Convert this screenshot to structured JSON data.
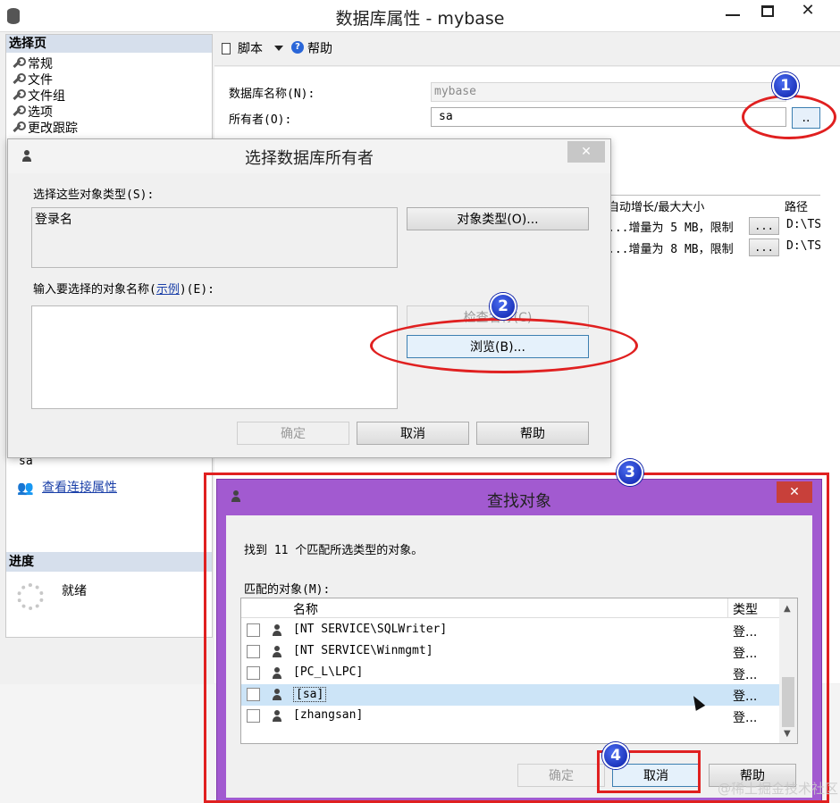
{
  "main_window": {
    "title": "数据库属性 - mybase"
  },
  "left_panel": {
    "header": "选择页",
    "items": [
      "常规",
      "文件",
      "文件组",
      "选项",
      "更改跟踪"
    ],
    "connection_value": "sa",
    "view_connection_link": "查看连接属性",
    "progress_header": "进度",
    "progress_status": "就绪"
  },
  "toolbar": {
    "script_label": "脚本",
    "help_label": "帮助"
  },
  "general": {
    "db_name_label": "数据库名称(N):",
    "db_name_value": "mybase",
    "owner_label": "所有者(O):",
    "owner_value": "sa",
    "owner_browse_button": ".."
  },
  "files_grid": {
    "headers": [
      "自动增长/最大大小",
      "路径"
    ],
    "rows": [
      {
        "growth": "增量为 5 MB，限制...",
        "path": "D:\\TS"
      },
      {
        "growth": "增量为 8 MB，限制...",
        "path": "D:\\TS"
      }
    ],
    "row_button": "..."
  },
  "owner_dialog": {
    "title": "选择数据库所有者",
    "types_label": "选择这些对象类型(S):",
    "types_value": "登录名",
    "object_types_button": "对象类型(O)...",
    "enter_label_prefix": "输入要选择的对象名称(",
    "enter_label_link": "示例",
    "enter_label_suffix": ")(E):",
    "check_names_button": "检查名称(C)",
    "browse_button": "浏览(B)...",
    "ok_button": "确定",
    "cancel_button": "取消",
    "help_button": "帮助"
  },
  "find_dialog": {
    "title": "查找对象",
    "found_text": "找到 11 个匹配所选类型的对象。",
    "matched_label": "匹配的对象(M):",
    "col_name": "名称",
    "col_type": "类型",
    "rows": [
      {
        "name": "[NT SERVICE\\SQLWriter]",
        "type": "登..."
      },
      {
        "name": "[NT SERVICE\\Winmgmt]",
        "type": "登..."
      },
      {
        "name": "[PC_L\\LPC]",
        "type": "登..."
      },
      {
        "name": "[sa]",
        "type": "登..."
      },
      {
        "name": "[zhangsan]",
        "type": "登..."
      }
    ],
    "ok_button": "确定",
    "cancel_button": "取消",
    "help_button": "帮助"
  },
  "annotations": {
    "badges": [
      "1",
      "2",
      "3",
      "4"
    ],
    "ring_color": "#e02020",
    "badge_color": "#1a2fc8"
  },
  "watermark": "@稀土掘金技术社区",
  "colors": {
    "find_titlebar": "#a25ad0",
    "selected_row": "#cce4f7"
  }
}
